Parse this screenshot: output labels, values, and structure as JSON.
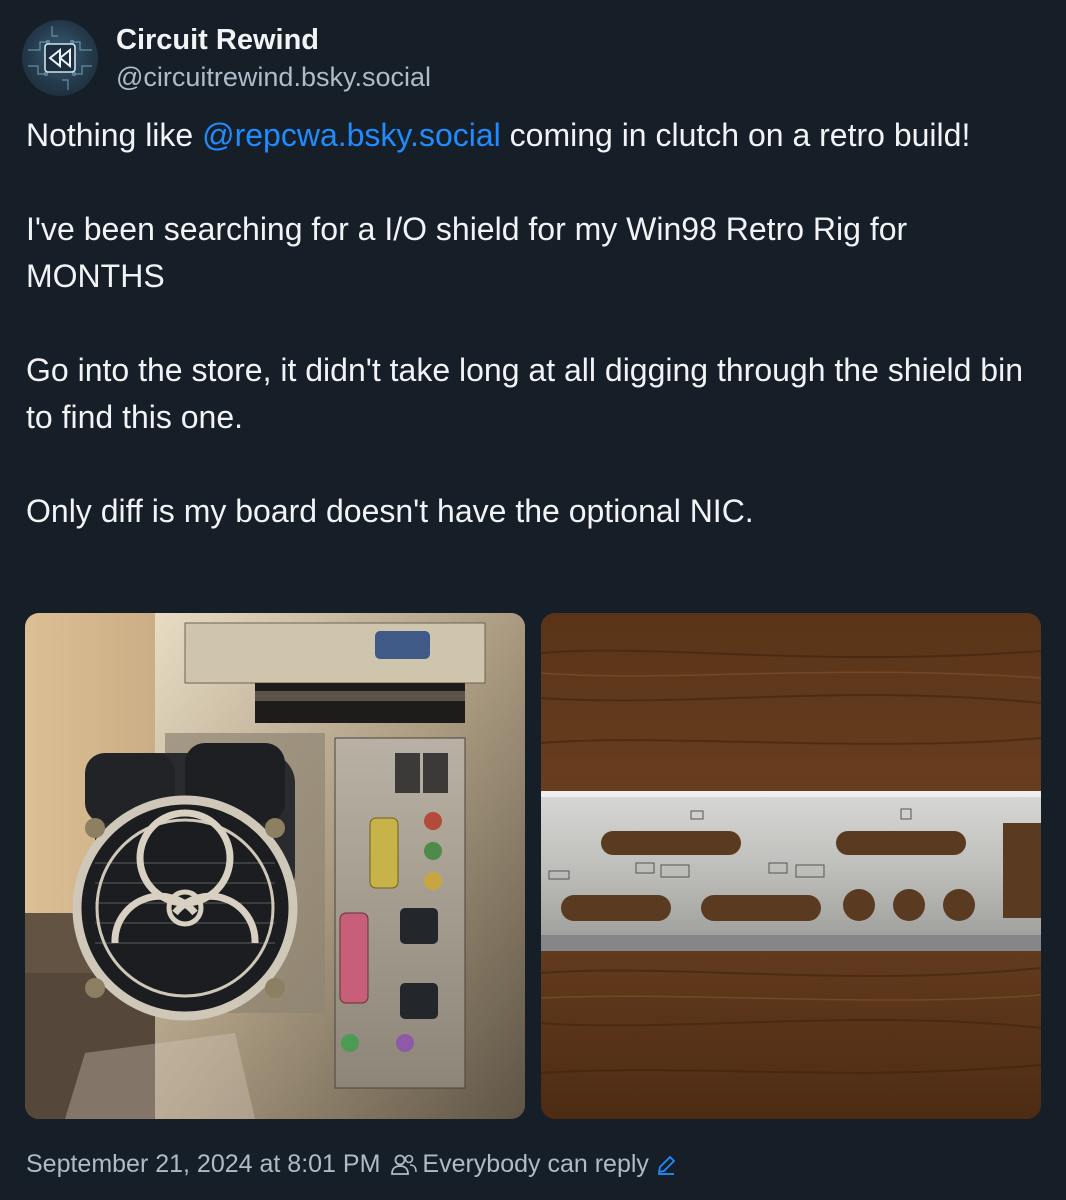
{
  "author": {
    "display_name": "Circuit Rewind",
    "handle": "@circuitrewind.bsky.social",
    "avatar_icon": "rewind-icon"
  },
  "post": {
    "line1_before": "Nothing like ",
    "mention": "@repcwa.bsky.social",
    "line1_after": " coming in clutch on a retro build!",
    "paragraph2": "I've been searching for a I/O shield for my Win98 Retro Rig for MONTHS",
    "paragraph3": "Go into the store, it didn't take long at all digging through the shield bin to find this one.",
    "paragraph4": "Only diff is my board doesn't have the optional NIC."
  },
  "images": [
    {
      "alt": "Retro PC case with biohazard fan grill and rear I/O ports"
    },
    {
      "alt": "Silver I/O shield lying on a wooden table"
    }
  ],
  "footer": {
    "timestamp": "September 21, 2024 at 8:01 PM",
    "reply_setting": "Everybody can reply",
    "people_icon": "people-icon",
    "edit_icon": "pencil-icon"
  },
  "colors": {
    "background": "#161e27",
    "mention": "#208bfe",
    "muted": "#aebbc9"
  }
}
